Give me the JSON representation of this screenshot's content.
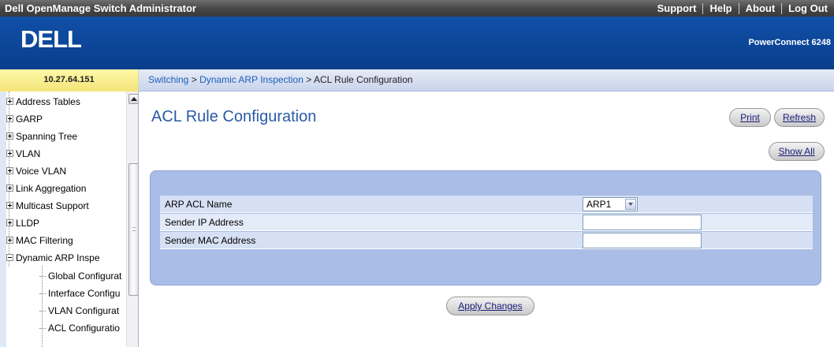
{
  "topbar": {
    "app_title": "Dell OpenManage Switch Administrator",
    "links": [
      "Support",
      "Help",
      "About",
      "Log Out"
    ]
  },
  "banner": {
    "logo_text": "DELL",
    "product": "PowerConnect 6248"
  },
  "ip_address": "10.27.64.151",
  "breadcrumb": {
    "items": [
      "Switching",
      "Dynamic ARP Inspection"
    ],
    "separator": ">",
    "current": "ACL Rule Configuration"
  },
  "sidebar": {
    "items": [
      {
        "label": "Address Tables",
        "state": "collapsed"
      },
      {
        "label": "GARP",
        "state": "collapsed"
      },
      {
        "label": "Spanning Tree",
        "state": "collapsed"
      },
      {
        "label": "VLAN",
        "state": "collapsed"
      },
      {
        "label": "Voice VLAN",
        "state": "collapsed"
      },
      {
        "label": "Link Aggregation",
        "state": "collapsed"
      },
      {
        "label": "Multicast Support",
        "state": "collapsed"
      },
      {
        "label": "LLDP",
        "state": "collapsed"
      },
      {
        "label": "MAC Filtering",
        "state": "collapsed"
      },
      {
        "label": "Dynamic ARP Inspe",
        "state": "expanded"
      }
    ],
    "subitems": [
      "Global Configurat",
      "Interface Configu",
      "VLAN Configurat",
      "ACL Configuratio"
    ]
  },
  "main": {
    "title": "ACL Rule Configuration",
    "buttons": {
      "print": "Print",
      "refresh": "Refresh",
      "show_all": "Show All",
      "apply": "Apply Changes"
    },
    "form": {
      "acl_name_label": "ARP ACL Name",
      "acl_name_value": "ARP1",
      "sender_ip_label": "Sender IP Address",
      "sender_ip_value": "",
      "sender_mac_label": "Sender MAC Address",
      "sender_mac_value": ""
    }
  },
  "colors": {
    "banner": "#0a3e8c",
    "title": "#2a5aa6",
    "panel": "#a9bde6",
    "ip_cell": "#f4e57a"
  }
}
